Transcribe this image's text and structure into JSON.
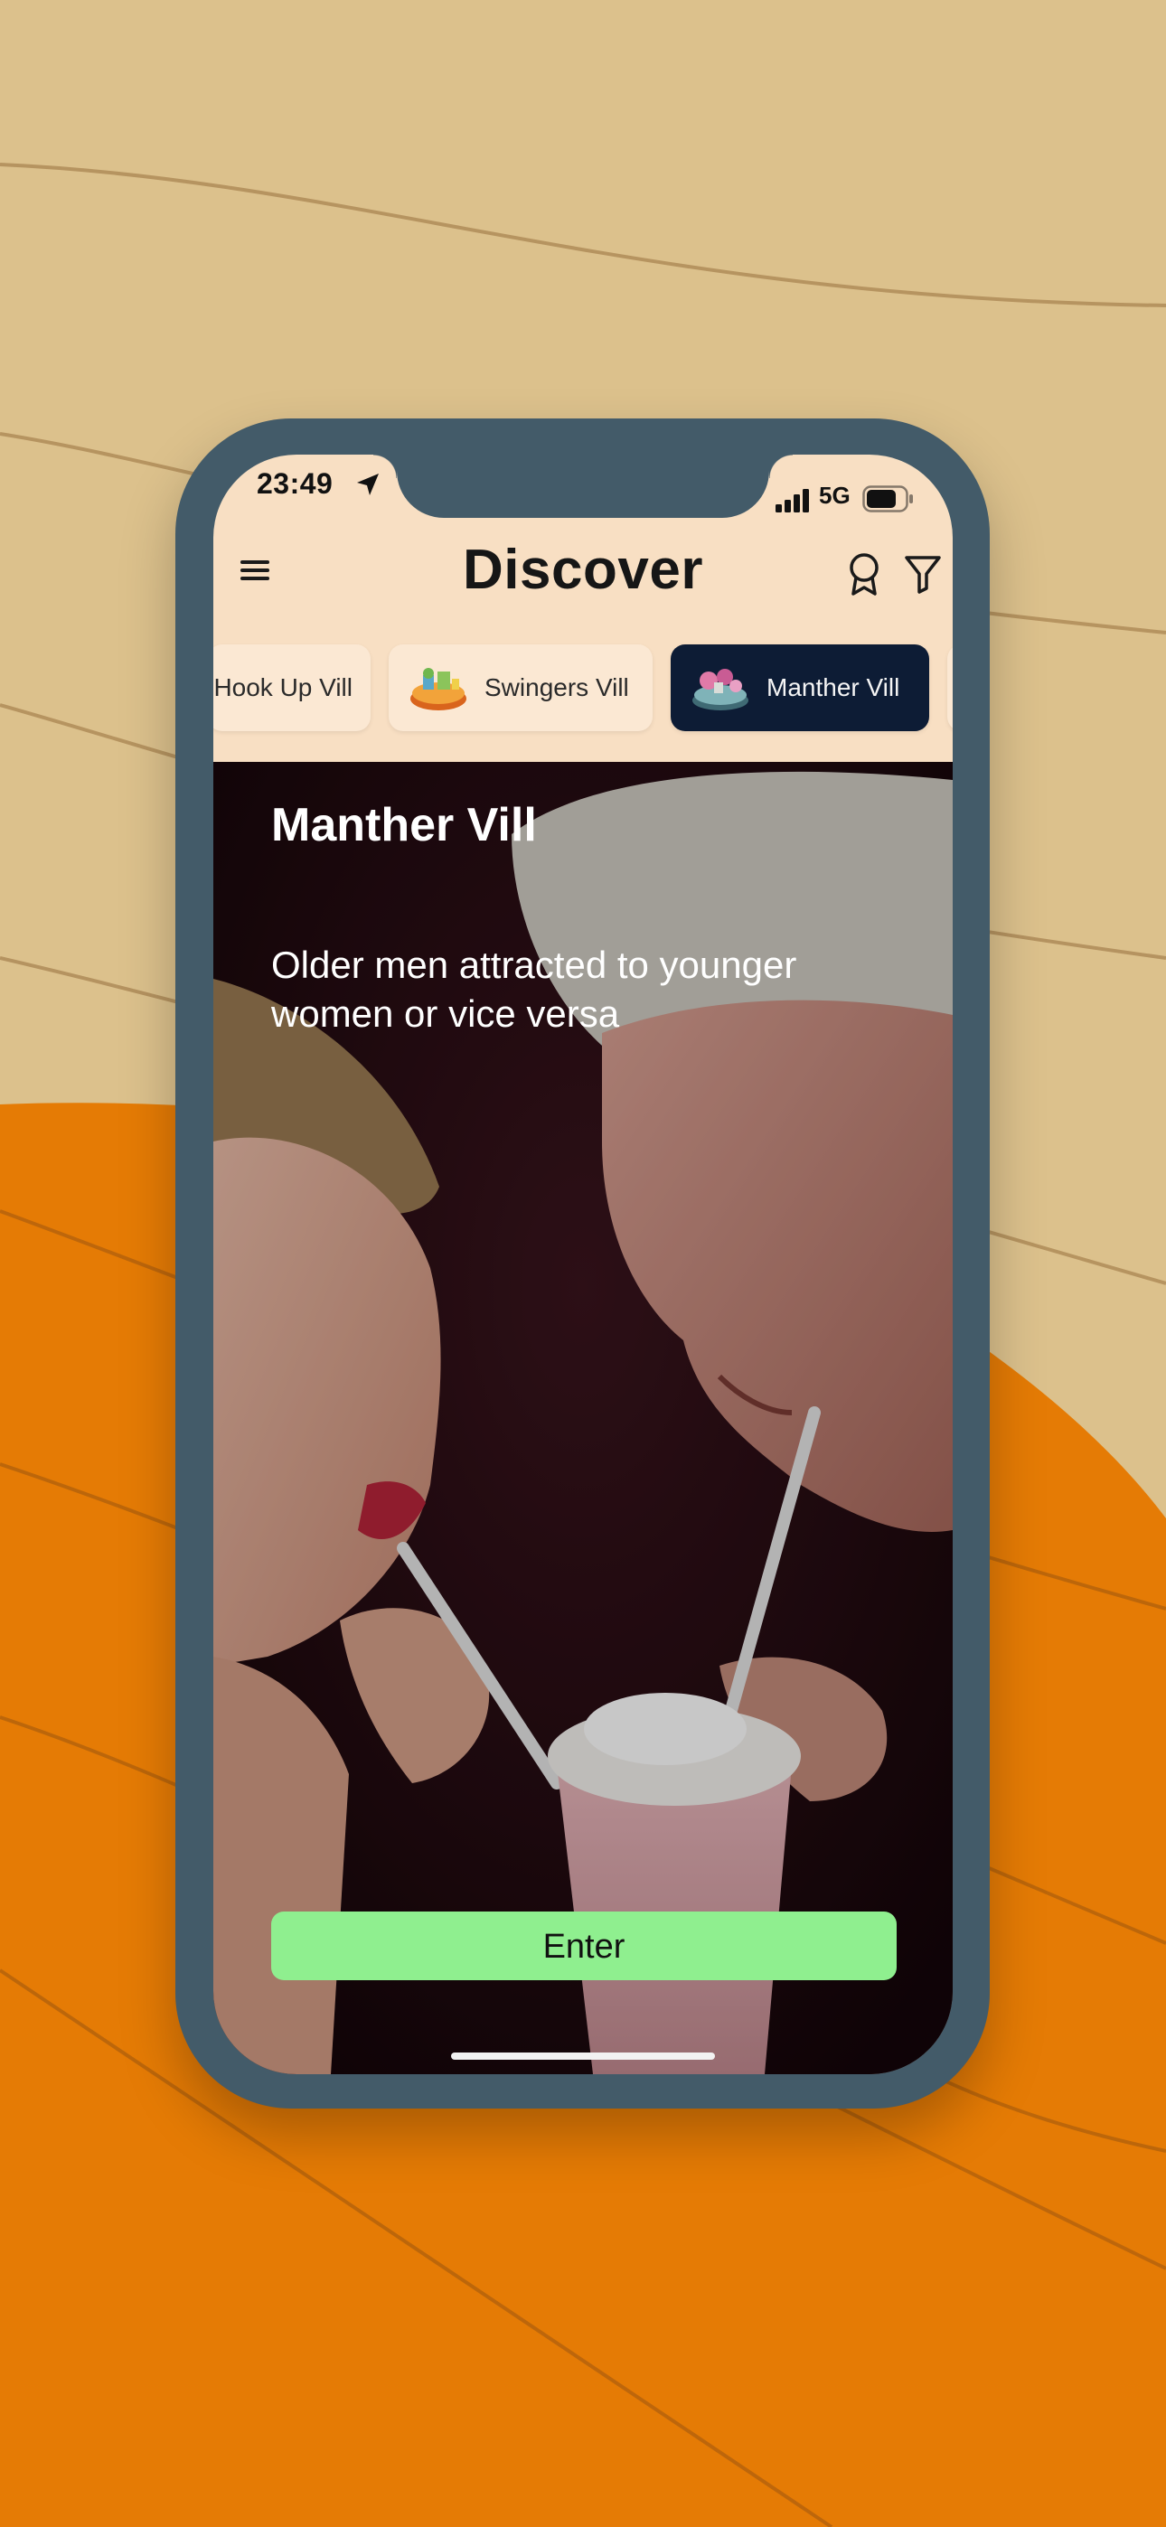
{
  "status_bar": {
    "time": "23:49",
    "network": "5G"
  },
  "header": {
    "title": "Discover"
  },
  "icons": {
    "menu": "menu-icon",
    "badge": "award-badge-icon",
    "filter": "filter-icon",
    "location": "location-arrow-icon",
    "signal": "signal-icon",
    "battery": "battery-icon"
  },
  "tabs": [
    {
      "label": "Hook Up Vill",
      "active": false
    },
    {
      "label": "Swingers Vill",
      "active": false
    },
    {
      "label": "Manther Vill",
      "active": true
    }
  ],
  "hero": {
    "name": "Manther Vill",
    "description": "Older men attracted to younger women or vice versa",
    "enter_label": "Enter"
  },
  "colors": {
    "background_tan": "#dcc18c",
    "background_orange": "#e57b05",
    "phone_frame": "#435b69",
    "header_bg": "#f8dfc3",
    "active_tab": "#0d1c35",
    "enter_button": "#8fef8f"
  }
}
